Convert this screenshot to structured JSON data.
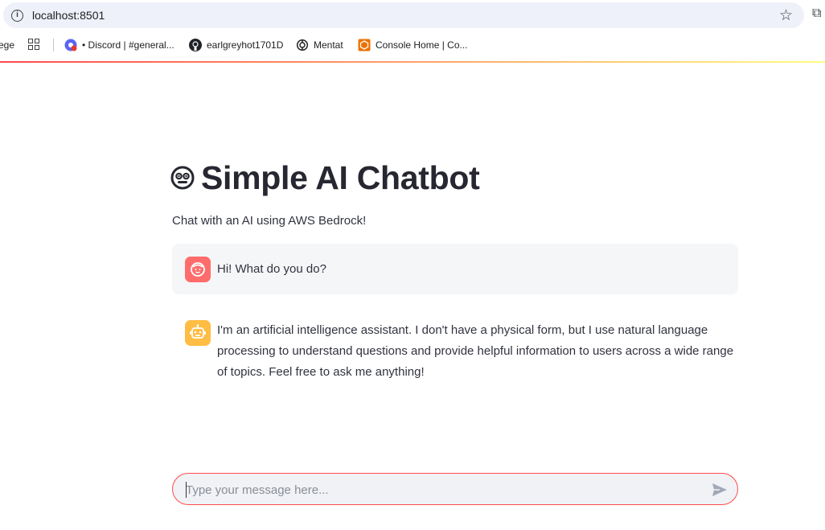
{
  "browser": {
    "url": "localhost:8501",
    "bookmarks": [
      {
        "label": "ege",
        "icon": "truncated-bookmark"
      },
      {
        "label": "• Discord | #general...",
        "icon": "discord-icon"
      },
      {
        "label": "earlgreyhot1701D",
        "icon": "github-icon"
      },
      {
        "label": "Mentat",
        "icon": "openai-icon"
      },
      {
        "label": "Console Home | Co...",
        "icon": "aws-icon"
      }
    ]
  },
  "app": {
    "title": "Simple AI Chatbot",
    "title_icon": "robot-face-emoji",
    "subtitle": "Chat with an AI using AWS Bedrock!",
    "messages": [
      {
        "role": "user",
        "avatar": "user-face-icon",
        "text": "Hi! What do you do?"
      },
      {
        "role": "assistant",
        "avatar": "bot-icon",
        "text": "I'm an artificial intelligence assistant. I don't have a physical form, but I use natural language processing to understand questions and provide helpful information to users across a wide range of topics. Feel free to ask me anything!"
      }
    ],
    "input": {
      "placeholder": "Type your message here...",
      "value": ""
    }
  },
  "colors": {
    "accent": "#ff4b4b",
    "user_avatar": "#ff6c6c",
    "bot_avatar": "#ffbd45",
    "user_bubble": "#f5f6f8"
  }
}
